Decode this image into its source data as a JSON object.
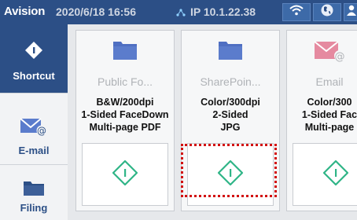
{
  "statusbar": {
    "brand": "Avision",
    "datetime": "2020/6/18 16:56",
    "ip_text": "IP 10.1.22.38",
    "icons": [
      "network-icon",
      "wifi-icon",
      "globe-icon",
      "user-icon"
    ]
  },
  "sidebar": {
    "items": [
      {
        "label": "Shortcut",
        "icon": "diamond-start-icon",
        "selected": true
      },
      {
        "label": "E-mail",
        "icon": "email-icon",
        "selected": false
      },
      {
        "label": "Filing",
        "icon": "folder-icon",
        "selected": false
      }
    ]
  },
  "cards": [
    {
      "name": "Public Fo...",
      "icon": "folder-icon",
      "settings": [
        "B&W/200dpi",
        "1-Sided FaceDown",
        "Multi-page PDF"
      ],
      "action_icon": "diamond-start-icon"
    },
    {
      "name": "SharePoin...",
      "icon": "folder-icon",
      "settings": [
        "Color/300dpi",
        "2-Sided",
        "JPG"
      ],
      "action_icon": "diamond-start-icon"
    },
    {
      "name": "Email",
      "icon": "email-icon",
      "settings": [
        "Color/300",
        "1-Sided Fac",
        "Multi-page"
      ],
      "action_icon": "diamond-start-icon"
    }
  ],
  "colors": {
    "brand_blue": "#2c4f86",
    "folder_blue": "#5b7ccc",
    "start_green": "#2fb587",
    "highlight_red": "#d20f0f"
  }
}
